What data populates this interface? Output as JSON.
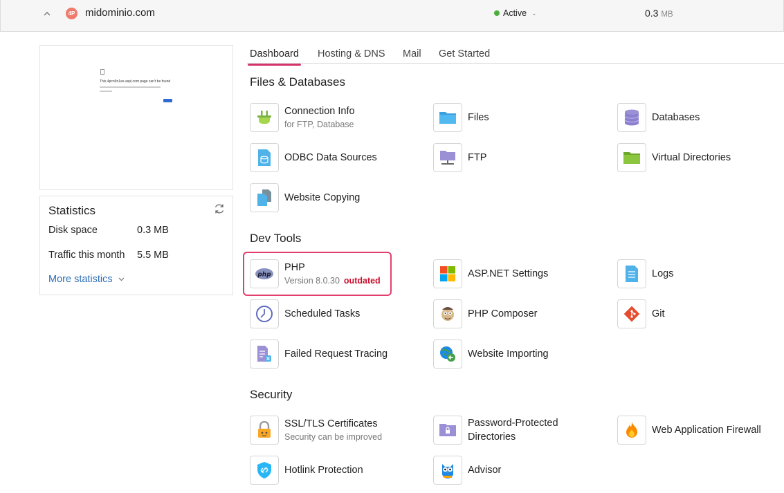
{
  "domain": {
    "name": "midominio.com",
    "logo_text": "4P",
    "status": "Active",
    "status_color": "#4caf3c",
    "size_value": "0.3",
    "size_unit": "MB"
  },
  "preview": {
    "title": "This 4pcn9n1ee.aspl.com page can't be found"
  },
  "statistics": {
    "title": "Statistics",
    "rows": [
      {
        "label": "Disk space",
        "value": "0.3 MB"
      },
      {
        "label": "Traffic this month",
        "value": "5.5 MB"
      }
    ],
    "more_label": "More statistics"
  },
  "tabs": [
    {
      "label": "Dashboard",
      "active": true
    },
    {
      "label": "Hosting & DNS",
      "active": false
    },
    {
      "label": "Mail",
      "active": false
    },
    {
      "label": "Get Started",
      "active": false
    }
  ],
  "sections": {
    "files": {
      "title": "Files & Databases",
      "items": {
        "connection": {
          "label": "Connection Info",
          "sub": "for FTP, Database"
        },
        "files": {
          "label": "Files"
        },
        "databases": {
          "label": "Databases"
        },
        "odbc": {
          "label": "ODBC Data Sources"
        },
        "ftp": {
          "label": "FTP"
        },
        "vdirs": {
          "label": "Virtual Directories"
        },
        "copying": {
          "label": "Website Copying"
        }
      }
    },
    "dev": {
      "title": "Dev Tools",
      "items": {
        "php": {
          "label": "PHP",
          "sub": "Version 8.0.30",
          "badge": "outdated"
        },
        "aspnet": {
          "label": "ASP.NET Settings"
        },
        "logs": {
          "label": "Logs"
        },
        "tasks": {
          "label": "Scheduled Tasks"
        },
        "composer": {
          "label": "PHP Composer"
        },
        "git": {
          "label": "Git"
        },
        "tracing": {
          "label": "Failed Request Tracing"
        },
        "importing": {
          "label": "Website Importing"
        }
      }
    },
    "security": {
      "title": "Security",
      "items": {
        "ssl": {
          "label": "SSL/TLS Certificates",
          "sub": "Security can be improved"
        },
        "pwdirs": {
          "label": "Password-Protected Directories"
        },
        "waf": {
          "label": "Web Application Firewall"
        },
        "hotlink": {
          "label": "Hotlink Protection"
        },
        "advisor": {
          "label": "Advisor"
        }
      }
    }
  },
  "colors": {
    "accent": "#d6336c",
    "link": "#2c6db5",
    "outdated": "#c8102e"
  }
}
